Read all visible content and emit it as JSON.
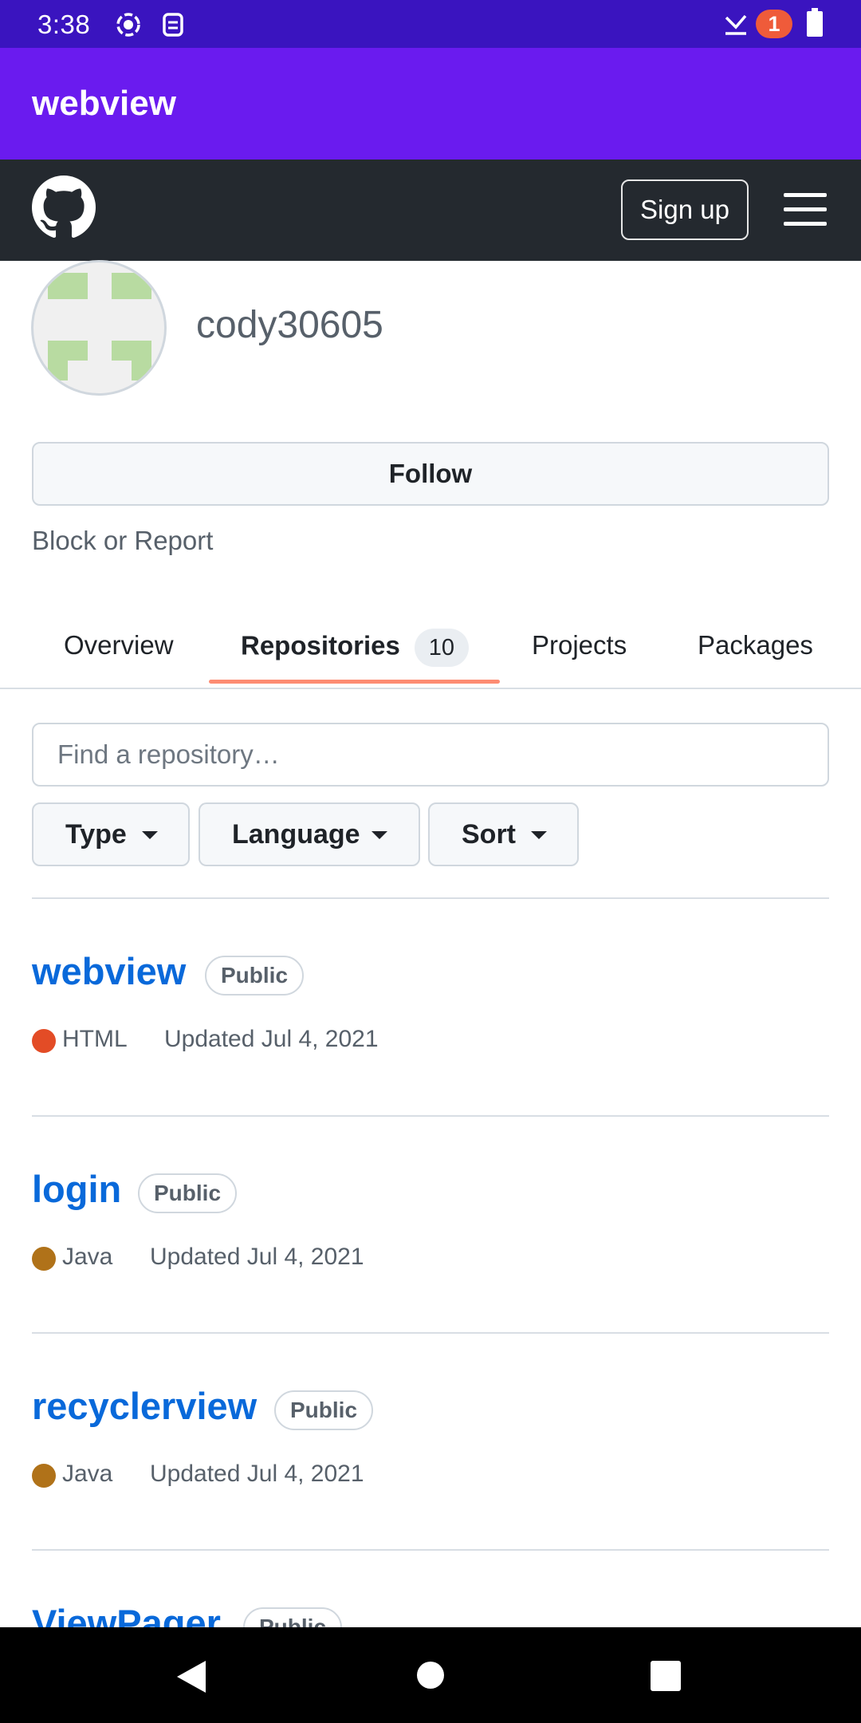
{
  "status_bar": {
    "time": "3:38",
    "notification_count": "1"
  },
  "app_bar": {
    "title": "webview"
  },
  "gh_header": {
    "signup_label": "Sign up"
  },
  "profile": {
    "username": "cody30605",
    "follow_label": "Follow",
    "block_label": "Block or Report"
  },
  "tabs": [
    {
      "label": "Overview"
    },
    {
      "label": "Repositories",
      "count": "10"
    },
    {
      "label": "Projects"
    },
    {
      "label": "Packages"
    }
  ],
  "search": {
    "placeholder": "Find a repository…"
  },
  "filters": [
    {
      "label": "Type"
    },
    {
      "label": "Language"
    },
    {
      "label": "Sort"
    }
  ],
  "repos": [
    {
      "name": "webview",
      "visibility": "Public",
      "language": "HTML",
      "language_color": "#e34c26",
      "updated": "Updated Jul 4, 2021"
    },
    {
      "name": "login",
      "visibility": "Public",
      "language": "Java",
      "language_color": "#b07219",
      "updated": "Updated Jul 4, 2021"
    },
    {
      "name": "recyclerview",
      "visibility": "Public",
      "language": "Java",
      "language_color": "#b07219",
      "updated": "Updated Jul 4, 2021"
    },
    {
      "name": "ViewPager",
      "visibility": "Public"
    }
  ],
  "colors": {
    "app_bar": "#6a1bef",
    "status_bar": "#3a14bf",
    "link": "#0969da",
    "tab_underline": "#fd8c73"
  }
}
